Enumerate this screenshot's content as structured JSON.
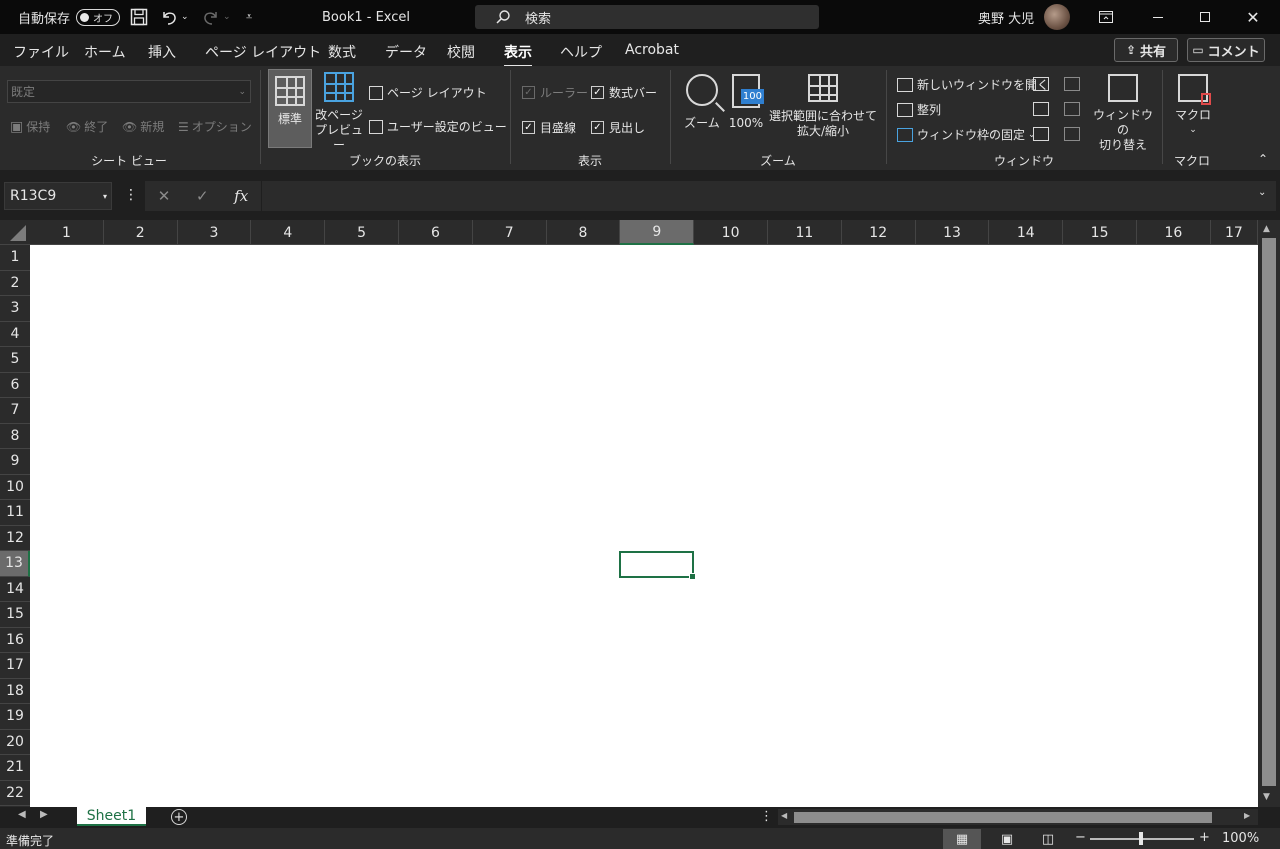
{
  "titlebar": {
    "autosave_label": "自動保存",
    "autosave_state": "オフ",
    "document_title": "Book1  -  Excel",
    "search_placeholder": "検索",
    "user_name": "奥野 大児"
  },
  "menu": {
    "tabs": [
      "ファイル",
      "ホーム",
      "挿入",
      "ページ レイアウト",
      "数式",
      "データ",
      "校閲",
      "表示",
      "ヘルプ",
      "Acrobat"
    ],
    "active_tab": "表示",
    "share_label": "共有",
    "comment_label": "コメント"
  },
  "ribbon": {
    "sheet_view": {
      "select_value": "既定",
      "keep_label": "保持",
      "exit_label": "終了",
      "new_label": "新規",
      "options_label": "オプション",
      "group_label": "シート ビュー"
    },
    "workbook_views": {
      "normal_label": "標準",
      "page_break_label": "改ページ\nプレビュー",
      "page_break_line1": "改ページ",
      "page_break_line2": "プレビュー",
      "page_layout_label": "ページ レイアウト",
      "custom_views_label": "ユーザー設定のビュー",
      "group_label": "ブックの表示"
    },
    "show": {
      "ruler_label": "ルーラー",
      "formula_bar_label": "数式バー",
      "gridlines_label": "目盛線",
      "headings_label": "見出し",
      "group_label": "表示"
    },
    "zoom": {
      "zoom_label": "ズーム",
      "hundred_label": "100%",
      "hundred_badge": "100",
      "fit_line1": "選択範囲に合わせて",
      "fit_line2": "拡大/縮小",
      "group_label": "ズーム"
    },
    "window": {
      "new_window_label": "新しいウィンドウを開く",
      "arrange_label": "整列",
      "freeze_label": "ウィンドウ枠の固定",
      "switch_line1": "ウィンドウの",
      "switch_line2": "切り替え",
      "group_label": "ウィンドウ"
    },
    "macros": {
      "macro_label": "マクロ",
      "group_label": "マクロ"
    }
  },
  "formula_bar": {
    "name_box": "R13C9",
    "fx_label": "fx",
    "formula_value": ""
  },
  "grid": {
    "columns": [
      "1",
      "2",
      "3",
      "4",
      "5",
      "6",
      "7",
      "8",
      "9",
      "10",
      "11",
      "12",
      "13",
      "14",
      "15",
      "16",
      "17"
    ],
    "rows": [
      "1",
      "2",
      "3",
      "4",
      "5",
      "6",
      "7",
      "8",
      "9",
      "10",
      "11",
      "12",
      "13",
      "14",
      "15",
      "16",
      "17",
      "18",
      "19",
      "20",
      "21",
      "22"
    ],
    "selected_row": "13",
    "selected_col": "9"
  },
  "sheets": {
    "tabs": [
      "Sheet1"
    ]
  },
  "status": {
    "ready_text": "準備完了",
    "zoom_percent": "100%",
    "zoom_level": 100
  },
  "colors": {
    "accent_green": "#1e7145",
    "ribbon_bg": "#2b2b2b",
    "titlebar_bg": "#0a0a0a"
  },
  "icons": [
    "save-icon",
    "undo-icon",
    "redo-icon",
    "customize-qat-icon",
    "search-icon",
    "ribbon-display-icon",
    "minimize-icon",
    "maximize-icon",
    "close-icon",
    "share-icon",
    "comment-icon",
    "normal-view-icon",
    "page-break-icon",
    "page-layout-icon",
    "custom-views-icon",
    "zoom-icon",
    "zoom-100-icon",
    "zoom-selection-icon",
    "new-window-icon",
    "arrange-icon",
    "freeze-panes-icon",
    "switch-windows-icon",
    "macro-icon",
    "cancel-icon",
    "enter-icon",
    "add-sheet-icon"
  ]
}
